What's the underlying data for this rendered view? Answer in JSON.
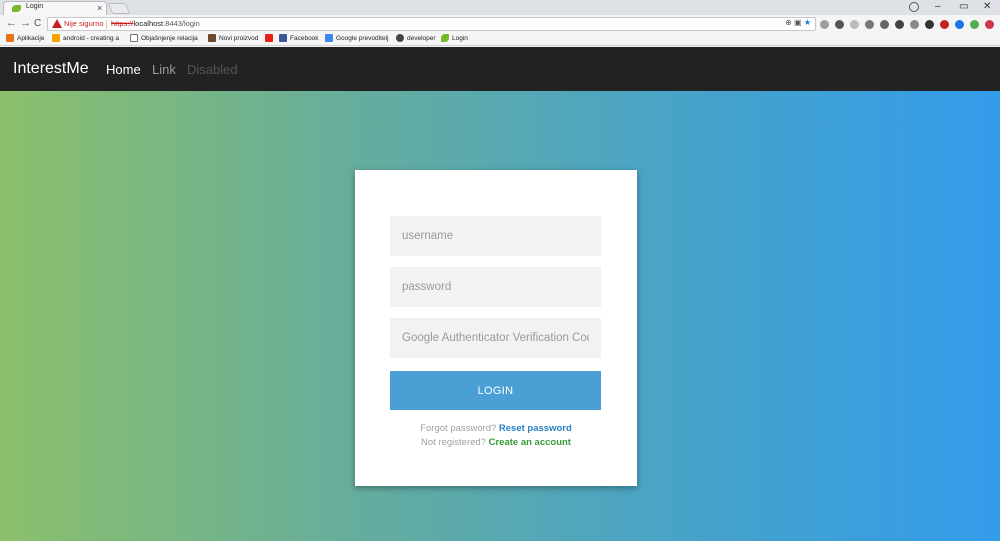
{
  "browser": {
    "tab_title": "Login",
    "tab_close": "×",
    "security_label": "Nije sigurno",
    "url_scheme": "https://",
    "url_host": "localhost",
    "url_rest": ":8443/login",
    "win_minimize": "–",
    "win_restore": "▭",
    "win_close": "✕",
    "nav_back": "←",
    "nav_forward": "→",
    "nav_reload": "C",
    "omni_icons": "⊕ ▣",
    "star": "★",
    "menu": "⋮"
  },
  "bookmarks": [
    {
      "label": "Aplikacije",
      "color": "#e8711c"
    },
    {
      "label": "android - creating a",
      "color": "#f4a300"
    },
    {
      "label": "Objašnjenje relacija",
      "color": "#ffffff"
    },
    {
      "label": "Novi proizvod",
      "color": "#6b4a2b"
    },
    {
      "label": "",
      "color": "#e62117"
    },
    {
      "label": "Facebook",
      "color": "#3b5998"
    },
    {
      "label": "Google prevoditelj",
      "color": "#4285f4"
    },
    {
      "label": "developer",
      "color": "#444444"
    },
    {
      "label": "Login",
      "color": "#78b82a"
    }
  ],
  "navbar": {
    "brand": "InterestMe",
    "links": [
      {
        "label": "Home",
        "state": "active"
      },
      {
        "label": "Link",
        "state": "normal"
      },
      {
        "label": "Disabled",
        "state": "disabled"
      }
    ]
  },
  "login_form": {
    "username_placeholder": "username",
    "password_placeholder": "password",
    "code_placeholder": "Google Authenticator Verification Code",
    "submit_label": "LOGIN",
    "forgot_text": "Forgot password?",
    "reset_link": "Reset password",
    "register_text": "Not registered?",
    "create_link": "Create an account"
  },
  "colors": {
    "navbar_bg": "#222222",
    "nav_active": "#ffffff",
    "nav_normal": "#9d9d9d",
    "nav_disabled": "#555555",
    "button_bg": "#4a9fd5",
    "reset_link": "#2a7fc1",
    "create_link": "#3a9a3a",
    "gradient_start": "#8bc06b",
    "gradient_end": "#339bea"
  }
}
